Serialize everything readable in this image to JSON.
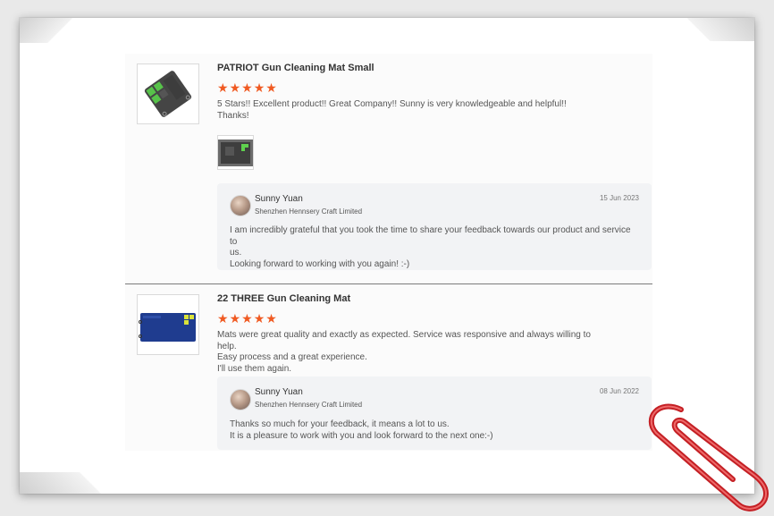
{
  "reviews": [
    {
      "product_title": "PATRIOT Gun Cleaning Mat Small",
      "rating_stars": 5,
      "text_lines": [
        "5 Stars!! Excellent product!! Great Company!! Sunny is very knowledgeable and helpful!!",
        "Thanks!"
      ],
      "reply": {
        "name": "Sunny Yuan",
        "company": "Shenzhen Hennsery Craft Limited",
        "date": "15 Jun 2023",
        "lines": [
          "I am incredibly grateful that you took the time to share your feedback towards our product and service to",
          "us.",
          "Looking forward to working with you again! :-)"
        ]
      }
    },
    {
      "product_title": "22 THREE Gun Cleaning Mat",
      "rating_stars": 5,
      "text_lines": [
        "Mats were great quality and exactly as expected. Service was responsive and always willing to help.",
        "Easy process and a great experience.",
        "I'll use them again."
      ],
      "reply": {
        "name": "Sunny Yuan",
        "company": "Shenzhen Hennsery Craft Limited",
        "date": "08 Jun 2022",
        "lines": [
          "Thanks so much for your feedback, it means a lot to us.",
          "It is a pleasure to work with you and look forward to the next one:-)"
        ]
      }
    }
  ],
  "colors": {
    "star": "#f05a22",
    "reply_bg": "#f2f3f5",
    "clip": "#d0242a"
  },
  "icons": [
    "star-icon",
    "avatar",
    "paperclip-icon"
  ]
}
